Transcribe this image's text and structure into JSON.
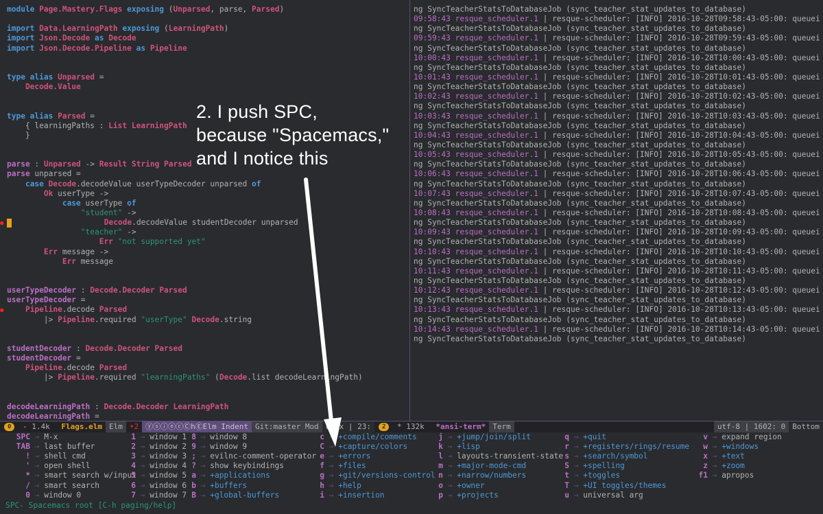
{
  "editor": {
    "lines": [
      [
        [
          "kw",
          "module "
        ],
        [
          "ty",
          "Page.Mastery.Flags"
        ],
        [
          "kw",
          " exposing "
        ],
        [
          "tx",
          "("
        ],
        [
          "ty",
          "Unparsed"
        ],
        [
          "tx",
          ", parse, "
        ],
        [
          "ty",
          "Parsed"
        ],
        [
          "tx",
          ")"
        ]
      ],
      [],
      [
        [
          "kw",
          "import "
        ],
        [
          "ty",
          "Data.LearningPath"
        ],
        [
          "kw",
          " exposing "
        ],
        [
          "tx",
          "("
        ],
        [
          "ty",
          "LearningPath"
        ],
        [
          "tx",
          ")"
        ]
      ],
      [
        [
          "kw",
          "import "
        ],
        [
          "ty",
          "Json.Decode"
        ],
        [
          "kw",
          " as "
        ],
        [
          "ty",
          "Decode"
        ]
      ],
      [
        [
          "kw",
          "import "
        ],
        [
          "ty",
          "Json.Decode.Pipeline"
        ],
        [
          "kw",
          " as "
        ],
        [
          "ty",
          "Pipeline"
        ]
      ],
      [],
      [],
      [
        [
          "kw",
          "type alias "
        ],
        [
          "ty",
          "Unparsed"
        ],
        [
          "tx",
          " ="
        ]
      ],
      [
        [
          "tx",
          "    "
        ],
        [
          "ty",
          "Decode.Value"
        ]
      ],
      [],
      [],
      [
        [
          "kw",
          "type alias "
        ],
        [
          "ty",
          "Parsed"
        ],
        [
          "tx",
          " ="
        ]
      ],
      [
        [
          "tx",
          "    { learningPaths : "
        ],
        [
          "ty",
          "List LearningPath"
        ]
      ],
      [
        [
          "tx",
          "    }"
        ]
      ],
      [],
      [],
      [
        [
          "fn",
          "parse"
        ],
        [
          "tx",
          " : "
        ],
        [
          "ty",
          "Unparsed"
        ],
        [
          "tx",
          " -> "
        ],
        [
          "ty",
          "Result String Parsed"
        ]
      ],
      [
        [
          "fn",
          "parse"
        ],
        [
          "tx",
          " unparsed ="
        ]
      ],
      [
        [
          "tx",
          "    "
        ],
        [
          "kw",
          "case "
        ],
        [
          "ty",
          "Decode"
        ],
        [
          "tx",
          ".decodeValue userTypeDecoder unparsed "
        ],
        [
          "kw",
          "of"
        ]
      ],
      [
        [
          "tx",
          "        "
        ],
        [
          "ty",
          "Ok"
        ],
        [
          "tx",
          " userType ->"
        ]
      ],
      [
        [
          "tx",
          "            "
        ],
        [
          "kw",
          "case"
        ],
        [
          "tx",
          " userType "
        ],
        [
          "kw",
          "of"
        ]
      ],
      [
        [
          "tx",
          "                "
        ],
        [
          "st",
          "\"student\""
        ],
        [
          "tx",
          " ->"
        ]
      ],
      [
        [
          "cursor",
          ""
        ],
        [
          "tx",
          "                    "
        ],
        [
          "ty",
          "Decode"
        ],
        [
          "tx",
          ".decodeValue studentDecoder unparsed"
        ]
      ],
      [
        [
          "tx",
          "                "
        ],
        [
          "st",
          "\"teacher\""
        ],
        [
          "tx",
          " ->"
        ]
      ],
      [
        [
          "tx",
          "                    "
        ],
        [
          "ty",
          "Err"
        ],
        [
          "st",
          " \"not supported yet\""
        ]
      ],
      [
        [
          "tx",
          "        "
        ],
        [
          "ty",
          "Err"
        ],
        [
          "tx",
          " message ->"
        ]
      ],
      [
        [
          "tx",
          "            "
        ],
        [
          "ty",
          "Err"
        ],
        [
          "tx",
          " message"
        ]
      ],
      [],
      [],
      [
        [
          "fn",
          "userTypeDecoder"
        ],
        [
          "tx",
          " : "
        ],
        [
          "ty",
          "Decode.Decoder Parsed"
        ]
      ],
      [
        [
          "fn",
          "userTypeDecoder"
        ],
        [
          "tx",
          " ="
        ]
      ],
      [
        [
          "tx",
          "    "
        ],
        [
          "ty",
          "Pipeline"
        ],
        [
          "tx",
          ".decode "
        ],
        [
          "ty",
          "Parsed"
        ]
      ],
      [
        [
          "tx",
          "        |> "
        ],
        [
          "ty",
          "Pipeline"
        ],
        [
          "tx",
          ".required "
        ],
        [
          "st",
          "\"userType\""
        ],
        [
          "tx",
          " "
        ],
        [
          "ty",
          "Decode"
        ],
        [
          "tx",
          ".string"
        ]
      ],
      [],
      [],
      [
        [
          "fn",
          "studentDecoder"
        ],
        [
          "tx",
          " : "
        ],
        [
          "ty",
          "Decode.Decoder Parsed"
        ]
      ],
      [
        [
          "fn",
          "studentDecoder"
        ],
        [
          "tx",
          " ="
        ]
      ],
      [
        [
          "tx",
          "    "
        ],
        [
          "ty",
          "Pipeline"
        ],
        [
          "tx",
          ".decode "
        ],
        [
          "ty",
          "Parsed"
        ]
      ],
      [
        [
          "tx",
          "        |> "
        ],
        [
          "ty",
          "Pipeline"
        ],
        [
          "tx",
          ".required "
        ],
        [
          "st",
          "\"learningPaths\""
        ],
        [
          "tx",
          " ("
        ],
        [
          "ty",
          "Decode"
        ],
        [
          "tx",
          ".list decodeLearningPath)"
        ]
      ],
      [],
      [],
      [
        [
          "fn",
          "decodeLearningPath"
        ],
        [
          "tx",
          " : "
        ],
        [
          "ty",
          "Decode.Decoder LearningPath"
        ]
      ],
      [
        [
          "fn",
          "decodeLearningPath"
        ],
        [
          "tx",
          " ="
        ]
      ]
    ]
  },
  "terminal": {
    "first_line": "ng SyncTeacherStatsToDatabaseJob (sync_teacher_stat_updates_to_database)",
    "entries": [
      {
        "ts": "09:58:43 resque_scheduler.1",
        "msg": " | resque-scheduler: [INFO] 2016-10-28T09:58:43-05:00: queuei",
        "cont": "ng SyncTeacherStatsToDatabaseJob (sync_teacher_stat_updates_to_database)"
      },
      {
        "ts": "09:59:43 resque_scheduler.1",
        "msg": " | resque-scheduler: [INFO] 2016-10-28T09:59:43-05:00: queuei",
        "cont": "ng SyncTeacherStatsToDatabaseJob (sync_teacher_stat_updates_to_database)"
      },
      {
        "ts": "10:00:43 resque_scheduler.1",
        "msg": " | resque-scheduler: [INFO] 2016-10-28T10:00:43-05:00: queuei",
        "cont": "ng SyncTeacherStatsToDatabaseJob (sync_teacher_stat_updates_to_database)"
      },
      {
        "ts": "10:01:43 resque_scheduler.1",
        "msg": " | resque-scheduler: [INFO] 2016-10-28T10:01:43-05:00: queuei",
        "cont": "ng SyncTeacherStatsToDatabaseJob (sync_teacher_stat_updates_to_database)"
      },
      {
        "ts": "10:02:43 resque_scheduler.1",
        "msg": " | resque-scheduler: [INFO] 2016-10-28T10:02:43-05:00: queuei",
        "cont": "ng SyncTeacherStatsToDatabaseJob (sync_teacher_stat_updates_to_database)"
      },
      {
        "ts": "10:03:43 resque_scheduler.1",
        "msg": " | resque-scheduler: [INFO] 2016-10-28T10:03:43-05:00: queuei",
        "cont": "ng SyncTeacherStatsToDatabaseJob (sync_teacher_stat_updates_to_database)"
      },
      {
        "ts": "10:04:43 resque_scheduler.1",
        "msg": " | resque-scheduler: [INFO] 2016-10-28T10:04:43-05:00: queuei",
        "cont": "ng SyncTeacherStatsToDatabaseJob (sync_teacher_stat_updates_to_database)"
      },
      {
        "ts": "10:05:43 resque_scheduler.1",
        "msg": " | resque-scheduler: [INFO] 2016-10-28T10:05:43-05:00: queuei",
        "cont": "ng SyncTeacherStatsToDatabaseJob (sync_teacher_stat_updates_to_database)"
      },
      {
        "ts": "10:06:43 resque_scheduler.1",
        "msg": " | resque-scheduler: [INFO] 2016-10-28T10:06:43-05:00: queuei",
        "cont": "ng SyncTeacherStatsToDatabaseJob (sync_teacher_stat_updates_to_database)"
      },
      {
        "ts": "10:07:43 resque_scheduler.1",
        "msg": " | resque-scheduler: [INFO] 2016-10-28T10:07:43-05:00: queuei",
        "cont": "ng SyncTeacherStatsToDatabaseJob (sync_teacher_stat_updates_to_database)"
      },
      {
        "ts": "10:08:43 resque_scheduler.1",
        "msg": " | resque-scheduler: [INFO] 2016-10-28T10:08:43-05:00: queuei",
        "cont": "ng SyncTeacherStatsToDatabaseJob (sync_teacher_stat_updates_to_database)"
      },
      {
        "ts": "10:09:43 resque_scheduler.1",
        "msg": " | resque-scheduler: [INFO] 2016-10-28T10:09:43-05:00: queuei",
        "cont": "ng SyncTeacherStatsToDatabaseJob (sync_teacher_stat_updates_to_database)"
      },
      {
        "ts": "10:10:43 resque_scheduler.1",
        "msg": " | resque-scheduler: [INFO] 2016-10-28T10:10:43-05:00: queuei",
        "cont": "ng SyncTeacherStatsToDatabaseJob (sync_teacher_stat_updates_to_database)"
      },
      {
        "ts": "10:11:43 resque_scheduler.1",
        "msg": " | resque-scheduler: [INFO] 2016-10-28T10:11:43-05:00: queuei",
        "cont": "ng SyncTeacherStatsToDatabaseJob (sync_teacher_stat_updates_to_database)"
      },
      {
        "ts": "10:12:43 resque_scheduler.1",
        "msg": " | resque-scheduler: [INFO] 2016-10-28T10:12:43-05:00: queuei",
        "cont": "ng SyncTeacherStatsToDatabaseJob (sync_teacher_stat_updates_to_database)"
      },
      {
        "ts": "10:13:43 resque_scheduler.1",
        "msg": " | resque-scheduler: [INFO] 2016-10-28T10:13:43-05:00: queuei",
        "cont": "ng SyncTeacherStatsToDatabaseJob (sync_teacher_stat_updates_to_database)"
      },
      {
        "ts": "10:14:43 resque_scheduler.1",
        "msg": " | resque-scheduler: [INFO] 2016-10-28T10:14:43-05:00: queuei",
        "cont": "ng SyncTeacherStatsToDatabaseJob (sync_teacher_stat_updates_to_database)"
      }
    ]
  },
  "modeline": {
    "left_window_num": "0",
    "left_size": " - 1.4k ",
    "left_buffer": "Flags.elm",
    "left_major": "Elm",
    "left_errors": "•2",
    "left_minor": "ⓨⓢⓘⓔⓒⒸhⒺElm Indent",
    "left_vc": "Git:master Mod",
    "left_encoding": "unix | 23:",
    "right_window_num": "2",
    "right_size": " * 132k ",
    "right_buffer": "*ansi-term*",
    "right_major": "Term",
    "right_encoding": "utf-8 | 1602: 0",
    "right_position": "Bottom"
  },
  "whichkey": {
    "columns": [
      [
        [
          "SPC",
          "M-x",
          ""
        ],
        [
          "TAB",
          "last buffer",
          ""
        ],
        [
          "!",
          "shell cmd",
          ""
        ],
        [
          "'",
          "open shell",
          ""
        ],
        [
          "*",
          "smart search w/input",
          ""
        ],
        [
          "/",
          "smart search",
          ""
        ],
        [
          "0",
          "window 0",
          ""
        ]
      ],
      [
        [
          "1",
          "window 1",
          ""
        ],
        [
          "2",
          "window 2",
          ""
        ],
        [
          "3",
          "window 3",
          ""
        ],
        [
          "4",
          "window 4",
          ""
        ],
        [
          "5",
          "window 5",
          ""
        ],
        [
          "6",
          "window 6",
          ""
        ],
        [
          "7",
          "window 7",
          ""
        ]
      ],
      [
        [
          "8",
          "window 8",
          ""
        ],
        [
          "9",
          "window 9",
          ""
        ],
        [
          ";",
          "evilnc-comment-operator",
          ""
        ],
        [
          "?",
          "show keybindings",
          ""
        ],
        [
          "a",
          "+applications",
          "g"
        ],
        [
          "b",
          "+buffers",
          "g"
        ],
        [
          "B",
          "+global-buffers",
          "g"
        ]
      ],
      [
        [
          "c",
          "+compile/comments",
          "g"
        ],
        [
          "C",
          "+capture/colors",
          "g"
        ],
        [
          "e",
          "+errors",
          "g"
        ],
        [
          "f",
          "+files",
          "g"
        ],
        [
          "g",
          "+git/versions-control",
          "g"
        ],
        [
          "h",
          "+help",
          "g"
        ],
        [
          "i",
          "+insertion",
          "g"
        ]
      ],
      [
        [
          "j",
          "+jump/join/split",
          "g"
        ],
        [
          "k",
          "+lisp",
          "g"
        ],
        [
          "l",
          "layouts-transient-state",
          ""
        ],
        [
          "m",
          "+major-mode-cmd",
          "g"
        ],
        [
          "n",
          "+narrow/numbers",
          "g"
        ],
        [
          "o",
          "+owner",
          "g"
        ],
        [
          "p",
          "+projects",
          "g"
        ]
      ],
      [
        [
          "q",
          "+quit",
          "g"
        ],
        [
          "r",
          "+registers/rings/resume",
          "g"
        ],
        [
          "s",
          "+search/symbol",
          "g"
        ],
        [
          "S",
          "+spelling",
          "g"
        ],
        [
          "t",
          "+toggles",
          "g"
        ],
        [
          "T",
          "+UI toggles/themes",
          "g"
        ],
        [
          "u",
          "universal arg",
          ""
        ]
      ],
      [
        [
          "v",
          "expand region",
          ""
        ],
        [
          "w",
          "+windows",
          "g"
        ],
        [
          "x",
          "+text",
          "g"
        ],
        [
          "z",
          "+zoom",
          "g"
        ],
        [
          "f1",
          "apropos",
          ""
        ]
      ]
    ]
  },
  "echo": "SPC- Spacemacs root [C-h paging/help]",
  "annotation": {
    "line1": "2. I push SPC,",
    "line2": "because \"Spacemacs,\"",
    "line3": "and I notice this"
  }
}
